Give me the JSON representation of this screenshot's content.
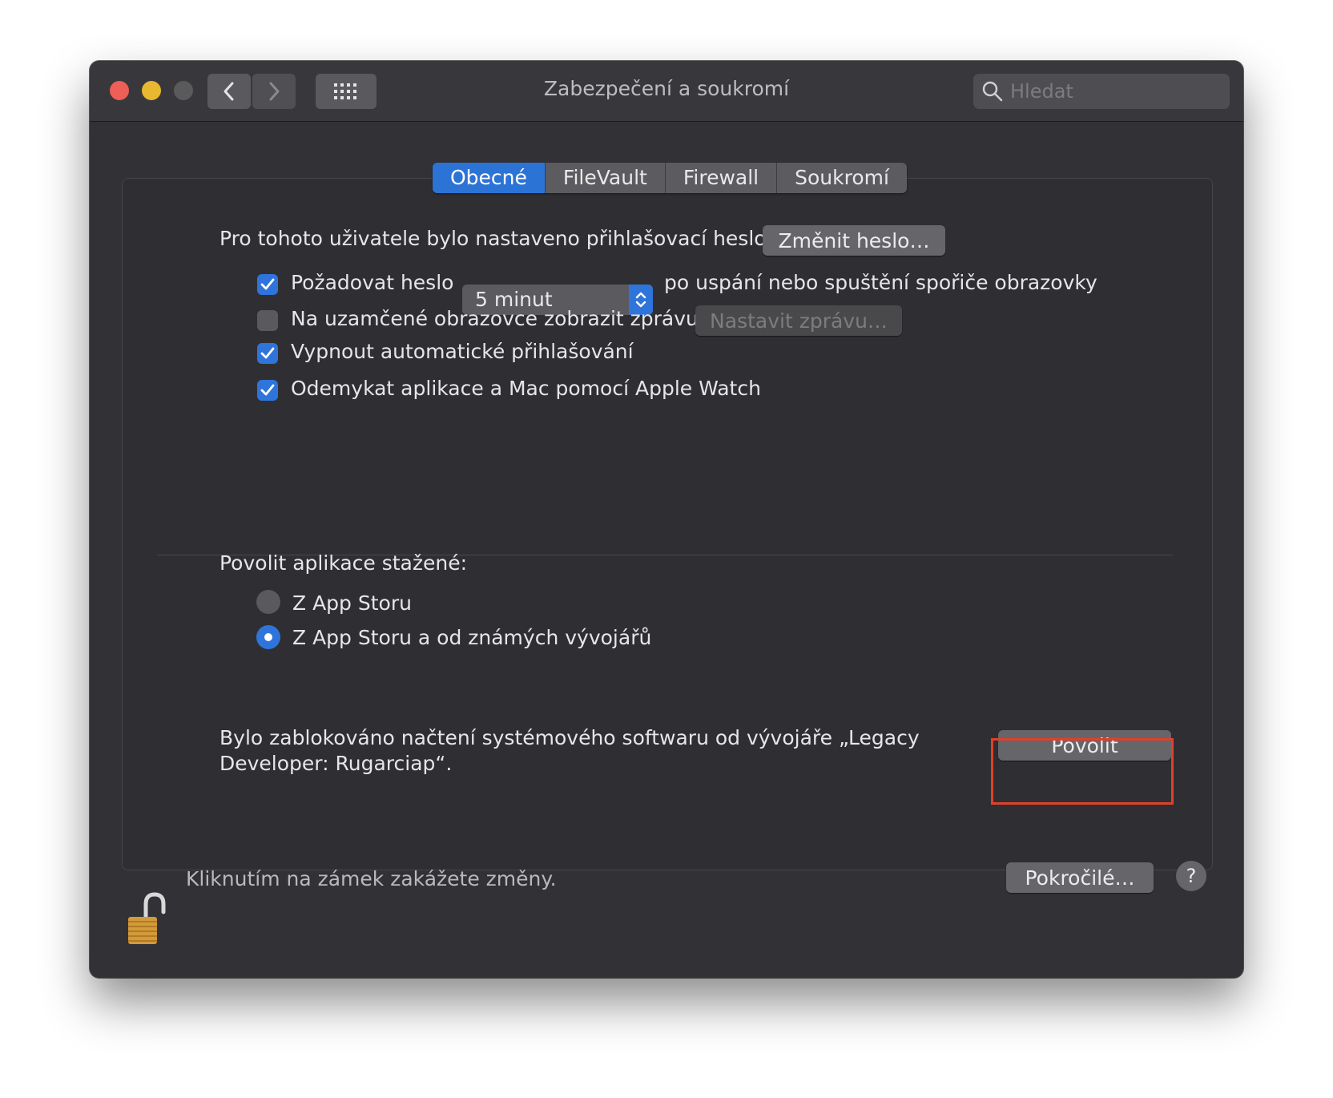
{
  "window": {
    "title": "Zabezpečení a soukromí",
    "search_placeholder": "Hledat"
  },
  "tabs": [
    {
      "label": "Obecné",
      "active": true
    },
    {
      "label": "FileVault",
      "active": false
    },
    {
      "label": "Firewall",
      "active": false
    },
    {
      "label": "Soukromí",
      "active": false
    }
  ],
  "general": {
    "password_text": "Pro tohoto uživatele bylo nastaveno přihlašovací heslo",
    "change_password_button": "Změnit heslo…",
    "require_password": {
      "label": "Požadovat heslo",
      "checked": true
    },
    "require_delay": "5 minut",
    "require_suffix": "po uspání nebo spuštění spořiče obrazovky",
    "lock_message": {
      "label": "Na uzamčené obrazovce zobrazit zprávu",
      "checked": false
    },
    "set_message_button": "Nastavit zprávu…",
    "disable_autologin": {
      "label": "Vypnout automatické přihlašování",
      "checked": true
    },
    "apple_watch": {
      "label": "Odemykat aplikace a Mac pomocí Apple Watch",
      "checked": true
    }
  },
  "downloads": {
    "heading": "Povolit aplikace stažené:",
    "options": [
      {
        "label": "Z App Storu",
        "selected": false
      },
      {
        "label": "Z App Storu a od známých vývojářů",
        "selected": true
      }
    ]
  },
  "blocked": {
    "message_line1": "Bylo zablokováno načtení systémového softwaru od vývojáře „Legacy",
    "message_line2": "Developer: Rugarciap“.",
    "allow_button": "Povolit",
    "highlight_color": "#e0402a"
  },
  "footer": {
    "lock_text": "Kliknutím na zámek zakážete změny.",
    "advanced_button": "Pokročilé…",
    "help_label": "?"
  },
  "colors": {
    "accent": "#2f74db",
    "window_bg": "#323236"
  }
}
